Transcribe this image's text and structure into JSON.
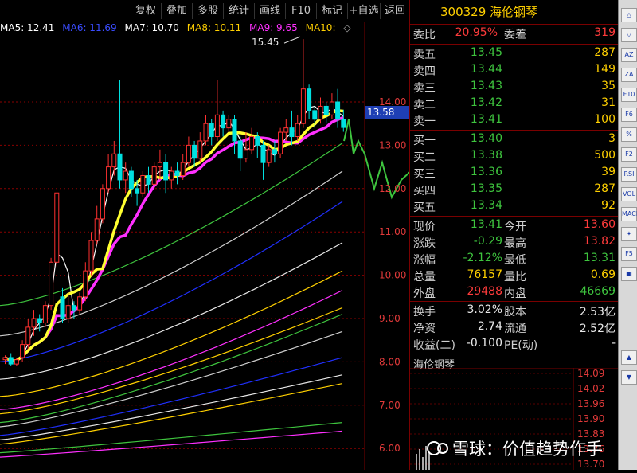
{
  "toolbar": {
    "buttons": [
      "复权",
      "叠加",
      "多股",
      "统计",
      "画线",
      "F10",
      "标记",
      "+自选",
      "返回"
    ]
  },
  "ma_legend": [
    {
      "label": "MA5: 12.41",
      "color": "#ffffff"
    },
    {
      "label": "MA6: 11.69",
      "color": "#3a4cff"
    },
    {
      "label": "MA7: 10.70",
      "color": "#ffffff"
    },
    {
      "label": "MA8: 10.11",
      "color": "#ffd000"
    },
    {
      "label": "MA9: 9.65",
      "color": "#ff30ff"
    },
    {
      "label": "MA10:",
      "color": "#ffd000"
    }
  ],
  "legend_more_icon": "diamond-icon",
  "chart": {
    "peak_label": "15.45",
    "price_tag": "13.58",
    "y_axis": [
      "14.00",
      "13.00",
      "12.00",
      "11.00",
      "10.00",
      "9.00",
      "8.00",
      "7.00",
      "6.00"
    ],
    "up_color": "#ff3030",
    "down_color": "#00e0e0"
  },
  "quote": {
    "stock_code": "300329",
    "stock_name": "海伦钢琴",
    "weibi_label": "委比",
    "weibi_value": "20.95%",
    "weicha_label": "委差",
    "weicha_value": "319",
    "asks": [
      {
        "label": "卖五",
        "price": "13.45",
        "volume": "287"
      },
      {
        "label": "卖四",
        "price": "13.44",
        "volume": "149"
      },
      {
        "label": "卖三",
        "price": "13.43",
        "volume": "35"
      },
      {
        "label": "卖二",
        "price": "13.42",
        "volume": "31"
      },
      {
        "label": "卖一",
        "price": "13.41",
        "volume": "100"
      }
    ],
    "bids": [
      {
        "label": "买一",
        "price": "13.40",
        "volume": "3"
      },
      {
        "label": "买二",
        "price": "13.38",
        "volume": "500"
      },
      {
        "label": "买三",
        "price": "13.36",
        "volume": "39"
      },
      {
        "label": "买四",
        "price": "13.35",
        "volume": "287"
      },
      {
        "label": "买五",
        "price": "13.34",
        "volume": "92"
      }
    ],
    "stats": [
      {
        "l1": "现价",
        "v1": "13.41",
        "l2": "今开",
        "v2": "13.60"
      },
      {
        "l1": "涨跌",
        "v1": "-0.29",
        "l2": "最高",
        "v2": "13.82"
      },
      {
        "l1": "涨幅",
        "v1": "-2.12%",
        "l2": "最低",
        "v2": "13.31"
      },
      {
        "l1": "总量",
        "v1": "76157",
        "l2": "量比",
        "v2": "0.69"
      },
      {
        "l1": "外盘",
        "v1": "29488",
        "l2": "内盘",
        "v2": "46669"
      }
    ],
    "fundamentals": [
      {
        "l1": "换手",
        "v1": "3.02%",
        "l2": "股本",
        "v2": "2.53亿"
      },
      {
        "l1": "净资",
        "v1": "2.74",
        "l2": "流通",
        "v2": "2.52亿"
      },
      {
        "l1": "收益(二)",
        "v1": "-0.100",
        "l2": "PE(动)",
        "v2": "-"
      }
    ]
  },
  "mini_chart": {
    "title": "海伦钢琴",
    "y_axis": [
      "14.09",
      "14.02",
      "13.96",
      "13.90",
      "13.83",
      "13.76",
      "13.70"
    ]
  },
  "side_strip": [
    "△",
    "▽",
    "AZ",
    "ZA",
    "F10",
    "F6",
    "%",
    "F2",
    "RSI",
    "VOL",
    "MACD",
    "✦",
    "F5",
    "▣"
  ],
  "watermark": "雪球：价值趋势作手"
}
